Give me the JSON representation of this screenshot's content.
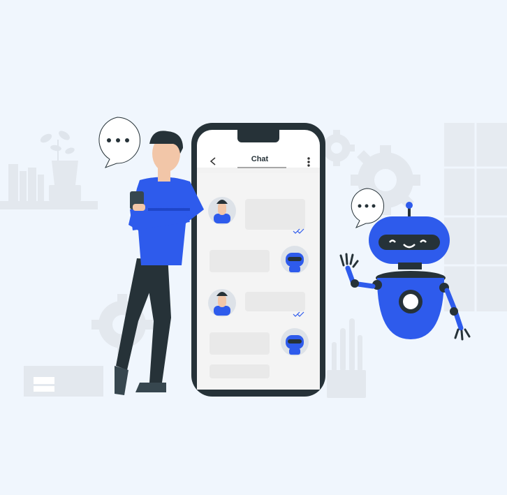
{
  "phone": {
    "header_title": "Chat",
    "back_icon": "chevron-left-icon",
    "menu_icon": "more-vertical-icon"
  },
  "colors": {
    "background": "#f0f6fd",
    "accent": "#2e5bec",
    "dark": "#263238",
    "bubble": "#e9e9e9",
    "check": "#2e5bec"
  },
  "icons": [
    "speech-bubble-icon",
    "gear-icon",
    "robot-icon",
    "phone-icon",
    "person-icon"
  ]
}
